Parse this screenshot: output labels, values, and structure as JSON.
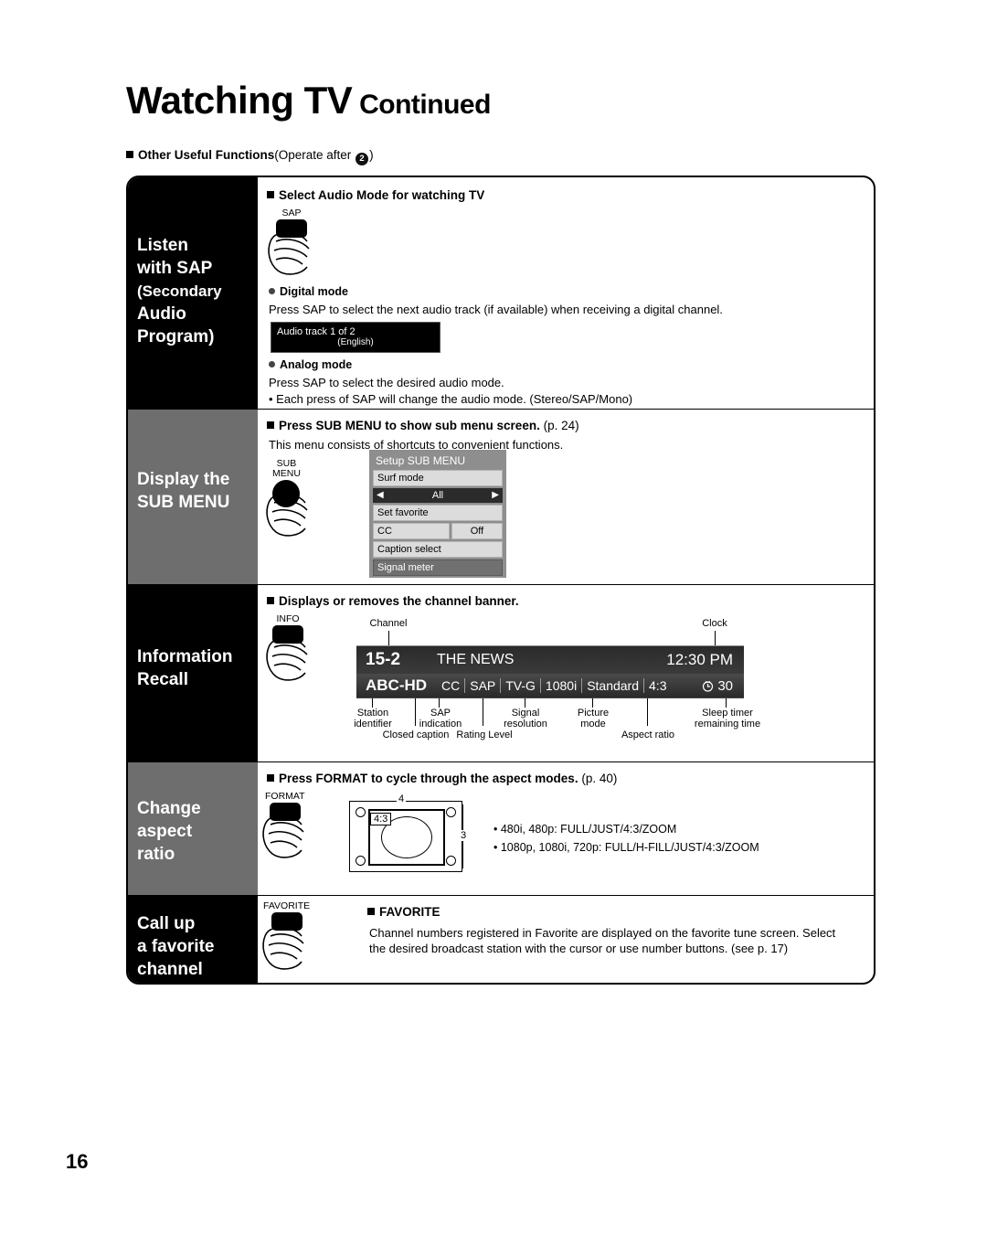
{
  "page": {
    "title_main": "Watching TV",
    "title_cont": "Continued",
    "section_header": "Other Useful Functions",
    "section_header_light": "(Operate after ",
    "section_header_light_end": ")",
    "operate_step": "2",
    "page_number": "16"
  },
  "rows": [
    {
      "label_lines": [
        "Listen",
        "with SAP",
        "(Secondary",
        "Audio",
        "Program)"
      ],
      "heading": "Select Audio Mode for watching TV",
      "key_label": "SAP",
      "sub1_title": "Digital mode",
      "sub1_text": "Press SAP to select the next audio track (if available) when receiving a digital channel.",
      "osd_line1": "Audio track 1 of 2",
      "osd_line2": "(English)",
      "sub2_title": "Analog mode",
      "sub2_text": "Press SAP to select the desired audio mode.",
      "sub2_note": "• Each press of SAP will change the audio mode. (Stereo/SAP/Mono)"
    },
    {
      "label_lines": [
        "Display the",
        "SUB MENU"
      ],
      "heading": "Press SUB MENU to show sub menu screen.",
      "heading_page": "(p. 24)",
      "body": "This menu consists of shortcuts to convenient functions.",
      "key_label_l1": "SUB",
      "key_label_l2": "MENU",
      "menu_title": "Setup SUB MENU",
      "menu_items": [
        "Surf mode",
        "All",
        "Set favorite",
        "CC",
        "Off",
        "Caption select",
        "Signal meter"
      ]
    },
    {
      "label_lines": [
        "Information",
        "Recall"
      ],
      "heading": "Displays or removes the channel banner.",
      "key_label": "INFO",
      "banner": {
        "channel": "15-2",
        "program": "THE NEWS",
        "clock": "12:30 PM",
        "station": "ABC-HD",
        "cc": "CC",
        "sap": "SAP",
        "rating": "TV-G",
        "resolution": "1080i",
        "picture_mode": "Standard",
        "aspect": "4:3",
        "sleep": "30"
      },
      "callouts": {
        "channel": "Channel",
        "clock": "Clock",
        "station": "Station\nidentifier",
        "sap": "SAP\nindication",
        "signal": "Signal\nresolution",
        "picture": "Picture\nmode",
        "sleep": "Sleep timer\nremaining time",
        "closed_caption": "Closed caption",
        "rating": "Rating Level",
        "aspect": "Aspect ratio"
      }
    },
    {
      "label_lines": [
        "Change",
        "aspect",
        "ratio"
      ],
      "heading": "Press FORMAT to cycle through the aspect modes.",
      "heading_page": "(p. 40)",
      "key_label": "FORMAT",
      "diagram": {
        "top": "4",
        "side": "3",
        "inner": "4:3"
      },
      "bullets": [
        "• 480i, 480p: FULL/JUST/4:3/ZOOM",
        "• 1080p, 1080i, 720p: FULL/H-FILL/JUST/4:3/ZOOM"
      ]
    },
    {
      "label_lines": [
        "Call up",
        "a favorite",
        "channel"
      ],
      "key_label": "FAVORITE",
      "heading": "FAVORITE",
      "body": "Channel numbers registered in Favorite are displayed on the favorite tune screen. Select the desired broadcast station with the cursor or use number buttons. (see p. 17)"
    }
  ]
}
